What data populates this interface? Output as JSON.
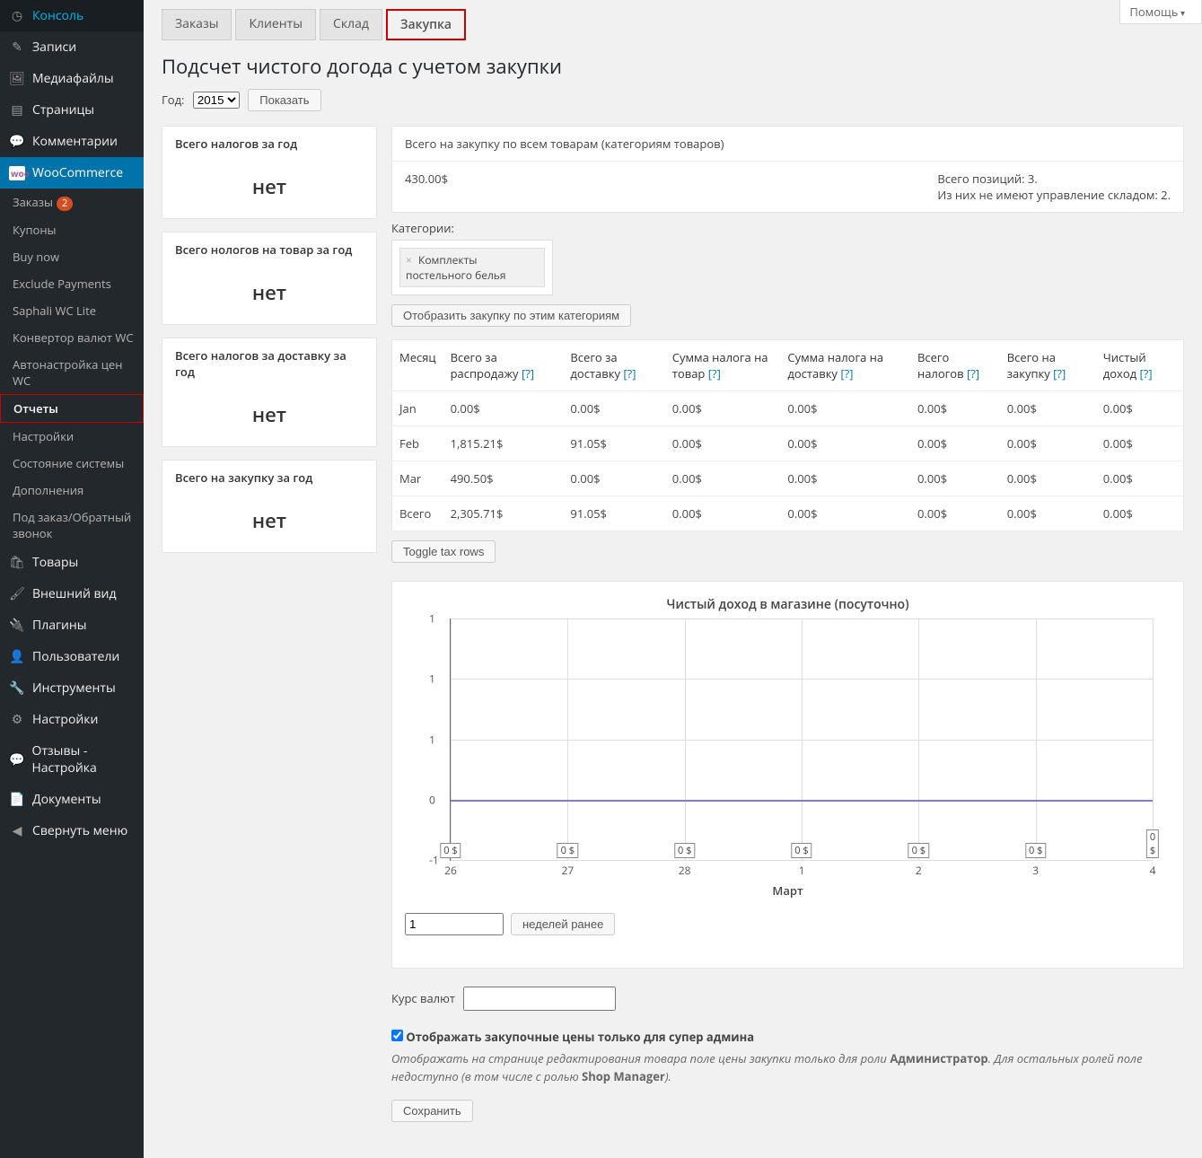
{
  "help_label": "Помощь",
  "sidebar": {
    "items": [
      {
        "icon": "◷",
        "label": "Консоль"
      },
      {
        "icon": "✎",
        "label": "Записи"
      },
      {
        "icon": "🖼",
        "label": "Медиафайлы"
      },
      {
        "icon": "▤",
        "label": "Страницы"
      },
      {
        "icon": "💬",
        "label": "Комментарии"
      }
    ],
    "woo": {
      "icon": "woo",
      "label": "WooCommerce"
    },
    "sub": [
      {
        "label": "Заказы",
        "badge": "2"
      },
      {
        "label": "Купоны"
      },
      {
        "label": "Buy now"
      },
      {
        "label": "Exclude Payments"
      },
      {
        "label": "Saphali WC Lite"
      },
      {
        "label": "Конвертор валют WC"
      },
      {
        "label": "Автонастройка цен WC"
      },
      {
        "label": "Отчеты",
        "current": true,
        "highlight": true
      },
      {
        "label": "Настройки"
      },
      {
        "label": "Состояние системы"
      },
      {
        "label": "Дополнения"
      },
      {
        "label": "Под заказ/Обратный звонок"
      }
    ],
    "items2": [
      {
        "icon": "🛍",
        "label": "Товары"
      },
      {
        "icon": "🖌",
        "label": "Внешний вид"
      },
      {
        "icon": "🔌",
        "label": "Плагины"
      },
      {
        "icon": "👤",
        "label": "Пользователи"
      },
      {
        "icon": "🔧",
        "label": "Инструменты"
      },
      {
        "icon": "⚙",
        "label": "Настройки"
      },
      {
        "icon": "💬",
        "label": "Отзывы - Настройка"
      },
      {
        "icon": "📄",
        "label": "Документы"
      },
      {
        "icon": "◀",
        "label": "Свернуть меню"
      }
    ]
  },
  "tabs": [
    "Заказы",
    "Клиенты",
    "Склад",
    "Закупка"
  ],
  "active_tab": 3,
  "page_title": "Подсчет чистого догода с учетом закупки",
  "year_label": "Год:",
  "year_value": "2015",
  "show_btn": "Показать",
  "left_cards": [
    {
      "title": "Всего налогов за год",
      "value": "нет"
    },
    {
      "title": "Всего нологов на товар за год",
      "value": "нет"
    },
    {
      "title": "Всего налогов за доставку за год",
      "value": "нет"
    },
    {
      "title": "Всего на закупку за год",
      "value": "нет"
    }
  ],
  "top_card": {
    "title": "Всего на закупку по всем товарам (категориям товаров)",
    "amount": "430.00$",
    "pos": "Всего позиций: 3.",
    "nostock": "Из них не имеют управление складом: 2."
  },
  "cat_label": "Категории:",
  "chip": "Комплекты постельного белья",
  "filter_btn": "Отобразить закупку по этим категориям",
  "table": {
    "headers": [
      "Месяц",
      "Всего за распродажу",
      "Всего за доставку",
      "Сумма налога на товар",
      "Сумма налога на доставку",
      "Всего налогов",
      "Всего на закупку",
      "Чистый доход"
    ],
    "rows": [
      [
        "Jan",
        "0.00$",
        "0.00$",
        "0.00$",
        "0.00$",
        "0.00$",
        "0.00$",
        "0.00$"
      ],
      [
        "Feb",
        "1,815.21$",
        "91.05$",
        "0.00$",
        "0.00$",
        "0.00$",
        "0.00$",
        "0.00$"
      ],
      [
        "Mar",
        "490.50$",
        "0.00$",
        "0.00$",
        "0.00$",
        "0.00$",
        "0.00$",
        "0.00$"
      ],
      [
        "Всего",
        "2,305.71$",
        "91.05$",
        "0.00$",
        "0.00$",
        "0.00$",
        "0.00$",
        "0.00$"
      ]
    ]
  },
  "toggle_btn": "Toggle tax rows",
  "chart_data": {
    "type": "line",
    "title": "Чистый доход в магазине (посуточно)",
    "xlabel": "Март",
    "ylabel": "",
    "y_ticks": [
      "1",
      "1",
      "1",
      "0",
      "-1"
    ],
    "categories": [
      "26",
      "27",
      "28",
      "1",
      "2",
      "3",
      "4"
    ],
    "series": [
      {
        "name": "income",
        "values": [
          0,
          0,
          0,
          0,
          0,
          0,
          0
        ],
        "labels": [
          "0 $",
          "0 $",
          "0 $",
          "0 $",
          "0 $",
          "0 $",
          "0 $"
        ]
      }
    ]
  },
  "weeks_value": "1",
  "weeks_btn": "неделей ранее",
  "rate_label": "Курс валют",
  "check_label": "Отображать закупочные цены только для супер админа",
  "desc_1": "Отображать на странице редактирования товара поле цены закупки только для роли ",
  "desc_b": "Администратор",
  "desc_2": ". Для остальных ролей поле недоступно (в том числе с ролью ",
  "desc_b2": "Shop Manager",
  "desc_3": ").",
  "save_btn": "Сохранить",
  "help_q": "[?]"
}
